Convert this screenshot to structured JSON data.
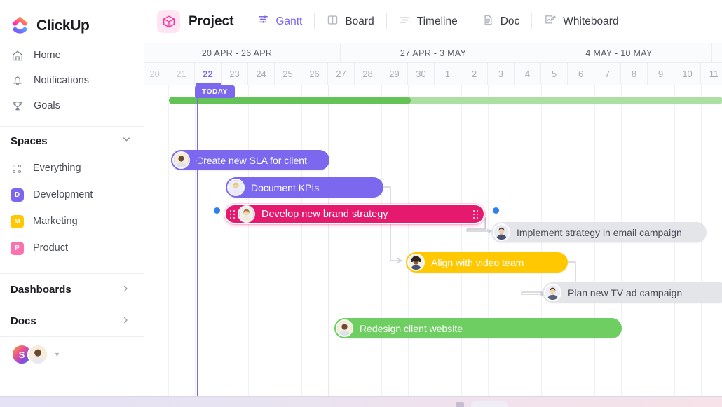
{
  "brand": {
    "name": "ClickUp",
    "accent_purple": "#7b68ee",
    "accent_pink": "#e5196e",
    "accent_green": "#6ece62",
    "accent_yellow": "#ffc800"
  },
  "sidebar": {
    "nav": [
      {
        "label": "Home",
        "icon": "home-icon"
      },
      {
        "label": "Notifications",
        "icon": "bell-icon"
      },
      {
        "label": "Goals",
        "icon": "trophy-icon"
      }
    ],
    "spaces_section": {
      "title": "Spaces",
      "chevron": "chevron-down-icon"
    },
    "spaces": [
      {
        "label": "Everything",
        "icon": "grid-dots-icon",
        "initial": "",
        "color": ""
      },
      {
        "label": "Development",
        "icon": "space-square",
        "initial": "D",
        "color": "#7b68ee"
      },
      {
        "label": "Marketing",
        "icon": "space-square",
        "initial": "M",
        "color": "#ffc800"
      },
      {
        "label": "Product",
        "icon": "space-square",
        "initial": "P",
        "color": "#fd71af"
      }
    ],
    "links": [
      {
        "label": "Dashboards",
        "chevron": "chevron-right-icon"
      },
      {
        "label": "Docs",
        "chevron": "chevron-right-icon"
      }
    ],
    "avatars": {
      "initial": "S",
      "caret": "caret-down-icon"
    }
  },
  "topbar": {
    "project": {
      "label": "Project",
      "icon": "cube-icon"
    },
    "tabs": [
      {
        "label": "Gantt",
        "icon": "gantt-icon",
        "active": true
      },
      {
        "label": "Board",
        "icon": "board-icon",
        "active": false
      },
      {
        "label": "Timeline",
        "icon": "timeline-icon",
        "active": false
      },
      {
        "label": "Doc",
        "icon": "doc-icon",
        "active": false
      },
      {
        "label": "Whiteboard",
        "icon": "whiteboard-icon",
        "active": false
      }
    ]
  },
  "chart_data": {
    "type": "gantt",
    "title": "Project Gantt",
    "weeks": [
      {
        "label": "20 APR - 26 APR",
        "start_day": "20",
        "end_day": "26"
      },
      {
        "label": "27 APR - 3 MAY",
        "start_day": "27",
        "end_day": "3"
      },
      {
        "label": "4 MAY - 10 MAY",
        "start_day": "4",
        "end_day": "10"
      }
    ],
    "days": [
      "20",
      "21",
      "22",
      "23",
      "24",
      "25",
      "26",
      "27",
      "28",
      "29",
      "30",
      "1",
      "2",
      "3",
      "4",
      "5",
      "6",
      "7",
      "8",
      "9",
      "10",
      "11"
    ],
    "today": {
      "day": "22",
      "badge": "TODAY"
    },
    "progress": {
      "label": "",
      "filled_through_day": "29",
      "total_end_day": "11"
    },
    "tasks": [
      {
        "name": "Create new SLA for client",
        "color": "purple",
        "start_day": "21",
        "end_day": "26",
        "assignee_style": "photo-dark",
        "selected": false
      },
      {
        "name": "Document KPIs",
        "color": "purple",
        "start_day": "23",
        "end_day": "29",
        "assignee_style": "photo-blonde",
        "selected": false
      },
      {
        "name": "Develop new brand strategy",
        "color": "pink",
        "start_day": "23",
        "end_day": "3",
        "assignee_style": "photo-woman",
        "selected": true
      },
      {
        "name": "Implement strategy in email campaign",
        "color": "gray",
        "start_day": "2",
        "end_day": "10",
        "assignee_style": "photo-man2",
        "selected": false
      },
      {
        "name": "Align with video team",
        "color": "yellow",
        "start_day": "29",
        "end_day": "4",
        "assignee_style": "photo-afro",
        "selected": false
      },
      {
        "name": "Plan new TV ad campaign",
        "color": "gray",
        "start_day": "5",
        "end_day": "11",
        "assignee_style": "photo-man3",
        "selected": false
      },
      {
        "name": "Redesign client website",
        "color": "green",
        "start_day": "27",
        "end_day": "9",
        "assignee_style": "photo-dark",
        "selected": false
      }
    ],
    "dependencies": [
      {
        "from": "Document KPIs",
        "to": "Align with video team"
      },
      {
        "from": "Develop new brand strategy",
        "to": "Implement strategy in email campaign"
      },
      {
        "from": "Align with video team",
        "to": "Plan new TV ad campaign"
      }
    ]
  }
}
